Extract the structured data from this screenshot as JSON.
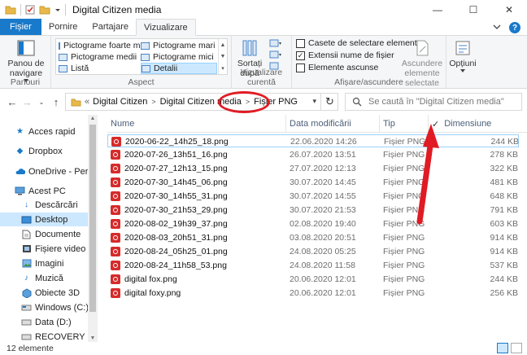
{
  "window": {
    "title": "Digital Citizen media",
    "controls": {
      "minimize": "—",
      "maximize": "☐",
      "close": "✕"
    }
  },
  "ribbon": {
    "tabs": [
      "Fișier",
      "Pornire",
      "Partajare",
      "Vizualizare"
    ],
    "groups": {
      "panes": {
        "label": "Panouri",
        "nav_pane": "Panou de navigare"
      },
      "layout": {
        "label": "Aspect",
        "items": [
          "Pictograme foarte mari",
          "Pictograme mari",
          "Pictograme medii",
          "Pictograme mici",
          "Listă",
          "Detalii"
        ],
        "selected": "Detalii"
      },
      "current_view": {
        "label": "Vizualizare curentă",
        "sort": "Sortați după"
      },
      "show_hide": {
        "label": "Afișare/ascundere",
        "checkboxes": [
          {
            "label": "Casete de selectare element",
            "checked": false
          },
          {
            "label": "Extensii nume de fișier",
            "checked": true
          },
          {
            "label": "Elemente ascunse",
            "checked": false
          }
        ],
        "hide_selected": "Ascundere elemente selectate"
      },
      "options": {
        "label": "Opțiuni"
      }
    }
  },
  "address": {
    "prefix": "«",
    "breadcrumb": [
      "Digital Citizen",
      "Digital Citizen media",
      "Fișier PNG"
    ],
    "search_placeholder": "Se caută în \"Digital Citizen media\""
  },
  "nav": {
    "items": [
      {
        "label": "Acces rapid",
        "icon": "star-icon"
      },
      {
        "label": "Dropbox",
        "icon": "dropbox-icon"
      },
      {
        "label": "OneDrive - Person",
        "icon": "cloud-icon"
      },
      {
        "label": "Acest PC",
        "icon": "pc-icon"
      },
      {
        "label": "Descărcări",
        "icon": "download-icon"
      },
      {
        "label": "Desktop",
        "icon": "desktop-icon",
        "selected": true
      },
      {
        "label": "Documente",
        "icon": "document-icon"
      },
      {
        "label": "Fișiere video",
        "icon": "video-icon"
      },
      {
        "label": "Imagini",
        "icon": "image-icon"
      },
      {
        "label": "Muzică",
        "icon": "music-icon"
      },
      {
        "label": "Obiecte 3D",
        "icon": "cube-icon"
      },
      {
        "label": "Windows (C:)",
        "icon": "drive-icon"
      },
      {
        "label": "Data (D:)",
        "icon": "drive-icon"
      },
      {
        "label": "RECOVERY (E:)",
        "icon": "drive-icon"
      }
    ]
  },
  "files": {
    "columns": {
      "name": "Nume",
      "date": "Data modificării",
      "type": "Tip",
      "size": "Dimensiune"
    },
    "rows": [
      {
        "name": "2020-06-22_14h25_18.png",
        "date": "22.06.2020 14:26",
        "type": "Fișier PNG",
        "size": "244 KB"
      },
      {
        "name": "2020-07-26_13h51_16.png",
        "date": "26.07.2020 13:51",
        "type": "Fișier PNG",
        "size": "278 KB"
      },
      {
        "name": "2020-07-27_12h13_15.png",
        "date": "27.07.2020 12:13",
        "type": "Fișier PNG",
        "size": "322 KB"
      },
      {
        "name": "2020-07-30_14h45_06.png",
        "date": "30.07.2020 14:45",
        "type": "Fișier PNG",
        "size": "481 KB"
      },
      {
        "name": "2020-07-30_14h55_31.png",
        "date": "30.07.2020 14:55",
        "type": "Fișier PNG",
        "size": "648 KB"
      },
      {
        "name": "2020-07-30_21h53_29.png",
        "date": "30.07.2020 21:53",
        "type": "Fișier PNG",
        "size": "791 KB"
      },
      {
        "name": "2020-08-02_19h39_37.png",
        "date": "02.08.2020 19:40",
        "type": "Fișier PNG",
        "size": "603 KB"
      },
      {
        "name": "2020-08-03_20h51_31.png",
        "date": "03.08.2020 20:51",
        "type": "Fișier PNG",
        "size": "914 KB"
      },
      {
        "name": "2020-08-24_05h25_01.png",
        "date": "24.08.2020 05:25",
        "type": "Fișier PNG",
        "size": "914 KB"
      },
      {
        "name": "2020-08-24_11h58_53.png",
        "date": "24.08.2020 11:58",
        "type": "Fișier PNG",
        "size": "537 KB"
      },
      {
        "name": "digital fox.png",
        "date": "20.06.2020 12:01",
        "type": "Fișier PNG",
        "size": "244 KB"
      },
      {
        "name": "digital foxy.png",
        "date": "20.06.2020 12:01",
        "type": "Fișier PNG",
        "size": "256 KB"
      }
    ]
  },
  "status": {
    "count": "12 elemente"
  },
  "colors": {
    "accent": "#1979ca",
    "selection": "#cce8ff",
    "annotation": "#e01b24"
  }
}
